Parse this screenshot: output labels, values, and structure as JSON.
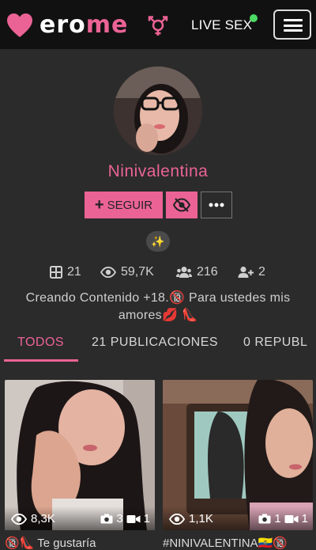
{
  "header": {
    "logo_text_white": "ero",
    "logo_text_pink": "me",
    "live_sex_label": "LIVE SEX"
  },
  "profile": {
    "username": "Ninivalentina",
    "follow_label": "SEGUIR",
    "sparkle_badge": "✨",
    "stats": {
      "albums": "21",
      "views": "59,7K",
      "followers": "216",
      "following": "2"
    },
    "bio_line1": "Creando Contenido +18.🔞 Para ustedes mis",
    "bio_line2": "amores💋 👠"
  },
  "tabs": [
    {
      "label": "TODOS"
    },
    {
      "label": "21 PUBLICACIONES"
    },
    {
      "label": "0 REPUBL"
    }
  ],
  "albums": [
    {
      "views": "8,3K",
      "photos": "3",
      "videos": "1",
      "title": "🔞👠 Te gustaría"
    },
    {
      "views": "1,1K",
      "photos": "1",
      "videos": "1",
      "title": "#NINIVALENTINA🇪🇨🔞"
    }
  ],
  "colors": {
    "accent": "#eb6395",
    "background": "#2b2b2b",
    "topbar": "#111111",
    "live_dot": "#4cd964"
  }
}
